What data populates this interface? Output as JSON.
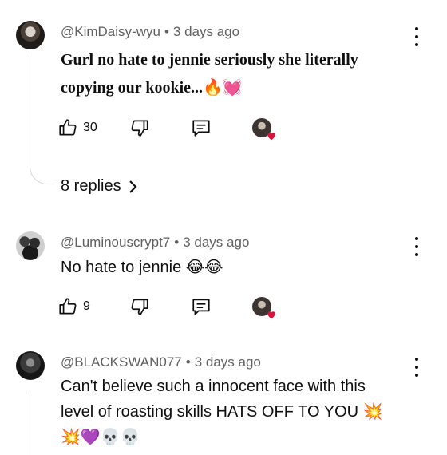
{
  "comments": [
    {
      "author": "@KimDaisy-wyu",
      "time": "3 days ago",
      "text_line1": "Gurl no hate to jennie seriously she literally",
      "text_line2": "copying our kookie...",
      "emojis": "🔥💓",
      "likes": "30",
      "replies_label": "8 replies"
    },
    {
      "author": "@Luminouscrypt7",
      "time": "3 days ago",
      "text_line1": "No hate to jennie",
      "emojis": "😂😂",
      "likes": "9"
    },
    {
      "author": "@BLACKSWAN077",
      "time": "3 days ago",
      "text_line1": "Can't believe such a innocent face with this",
      "text_line2": "level of roasting skills HATS OFF TO YOU",
      "emojis_line2": "💥",
      "emojis_line3": "💥💜💀💀"
    }
  ],
  "separator": "•",
  "colors": {
    "heart": "#e0103a",
    "meta": "#606060",
    "text": "#0f0f0f"
  }
}
